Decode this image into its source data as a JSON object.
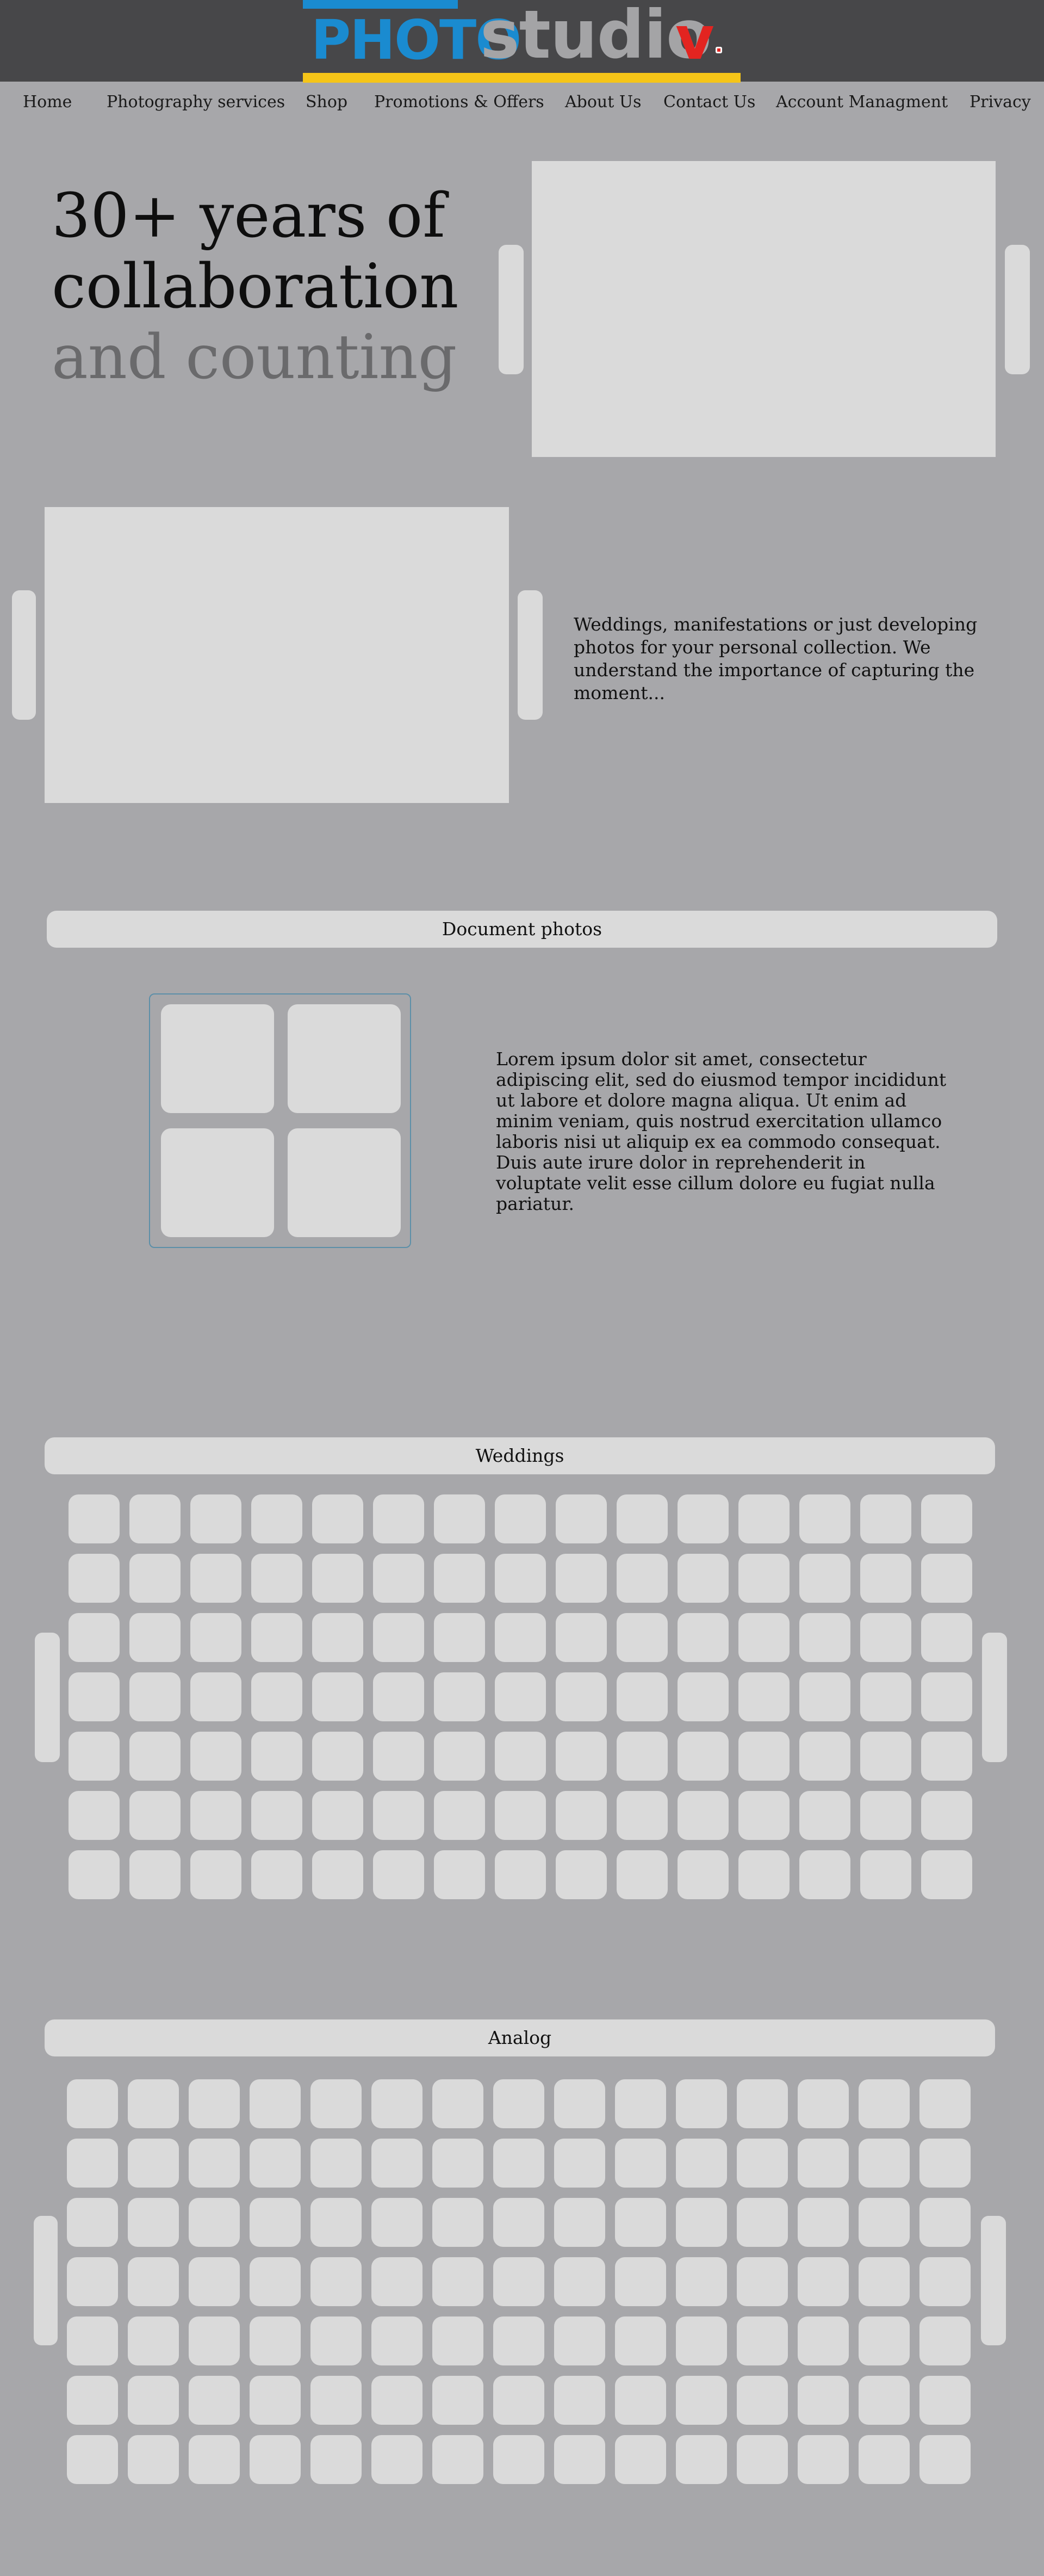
{
  "logo": {
    "photo": "PHOTO",
    "studio": "studio",
    "v": "v"
  },
  "nav": [
    {
      "label": "Home"
    },
    {
      "label": "Photography services"
    },
    {
      "label": "Shop"
    },
    {
      "label": "Promotions & Offers"
    },
    {
      "label": "About Us"
    },
    {
      "label": "Contact Us"
    },
    {
      "label": "Account Managment"
    },
    {
      "label": "Privacy"
    }
  ],
  "hero": {
    "line1": "30+ years of",
    "line2": "collaboration",
    "line3": "and counting"
  },
  "intro_text": "Weddings, manifestations or just developing photos for your personal collection. We understand the importance of capturing the moment...",
  "document_photos": {
    "title": "Document photos",
    "text": "Lorem ipsum dolor sit amet, consectetur adipiscing elit, sed do eiusmod  tempor incididunt ut labore et dolore magna aliqua. Ut enim ad minim  veniam, quis nostrud exercitation ullamco laboris nisi ut aliquip ex ea commodo consequat. Duis aute irure dolor in reprehenderit in voluptate  velit esse cillum dolore eu fugiat nulla pariatur."
  },
  "weddings": {
    "title": "Weddings"
  },
  "analog": {
    "title": "Analog"
  },
  "colors": {
    "background": "#a7a7aa",
    "header": "#474749",
    "placeholder": "#dadada",
    "logo_blue": "#1a8bd0",
    "logo_yellow": "#f5c518",
    "logo_red": "#e32420"
  }
}
